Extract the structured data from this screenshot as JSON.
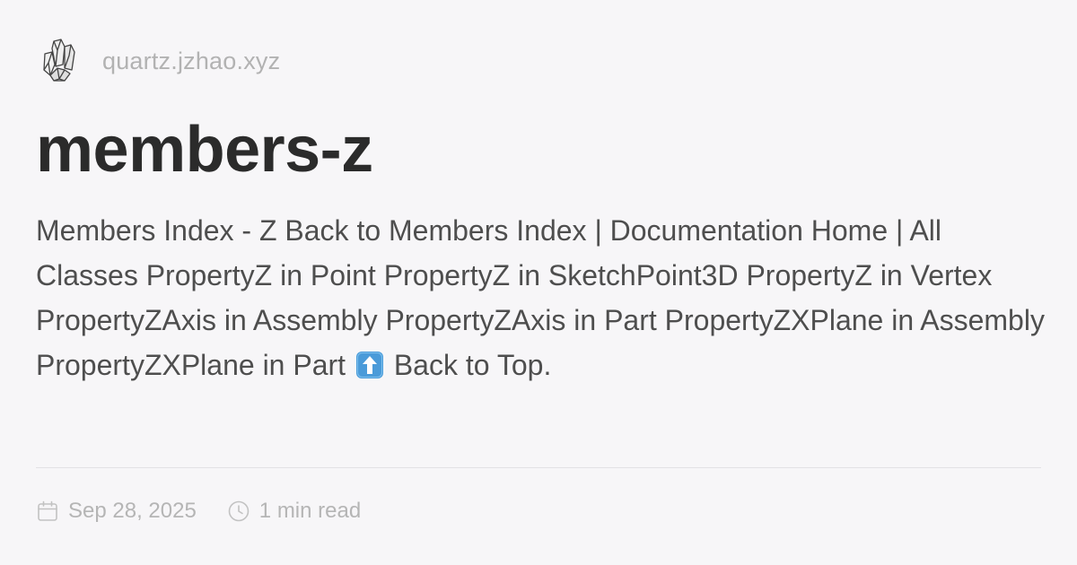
{
  "site": {
    "logo_icon": "crystal-cluster-icon",
    "name": "quartz.jzhao.xyz"
  },
  "page": {
    "title": "members-z",
    "description_before_emoji": "Members Index - Z Back to Members Index | Documentation Home | All Classes PropertyZ in Point PropertyZ in SketchPoint3D PropertyZ in Vertex PropertyZAxis in Assembly PropertyZAxis in Part PropertyZXPlane in Assembly PropertyZXPlane in Part",
    "emoji_icon": "up-arrow-emoji-icon",
    "description_after_emoji": "Back to Top."
  },
  "meta": {
    "date_icon": "calendar-icon",
    "date": "Sep 28, 2025",
    "read_icon": "clock-icon",
    "read_time": "1 min read"
  },
  "colors": {
    "background": "#f7f6f8",
    "title": "#2b2b2b",
    "body_text": "#4e4e4e",
    "muted": "#b5b5b5",
    "emoji_blue": "#4a9bd9"
  }
}
